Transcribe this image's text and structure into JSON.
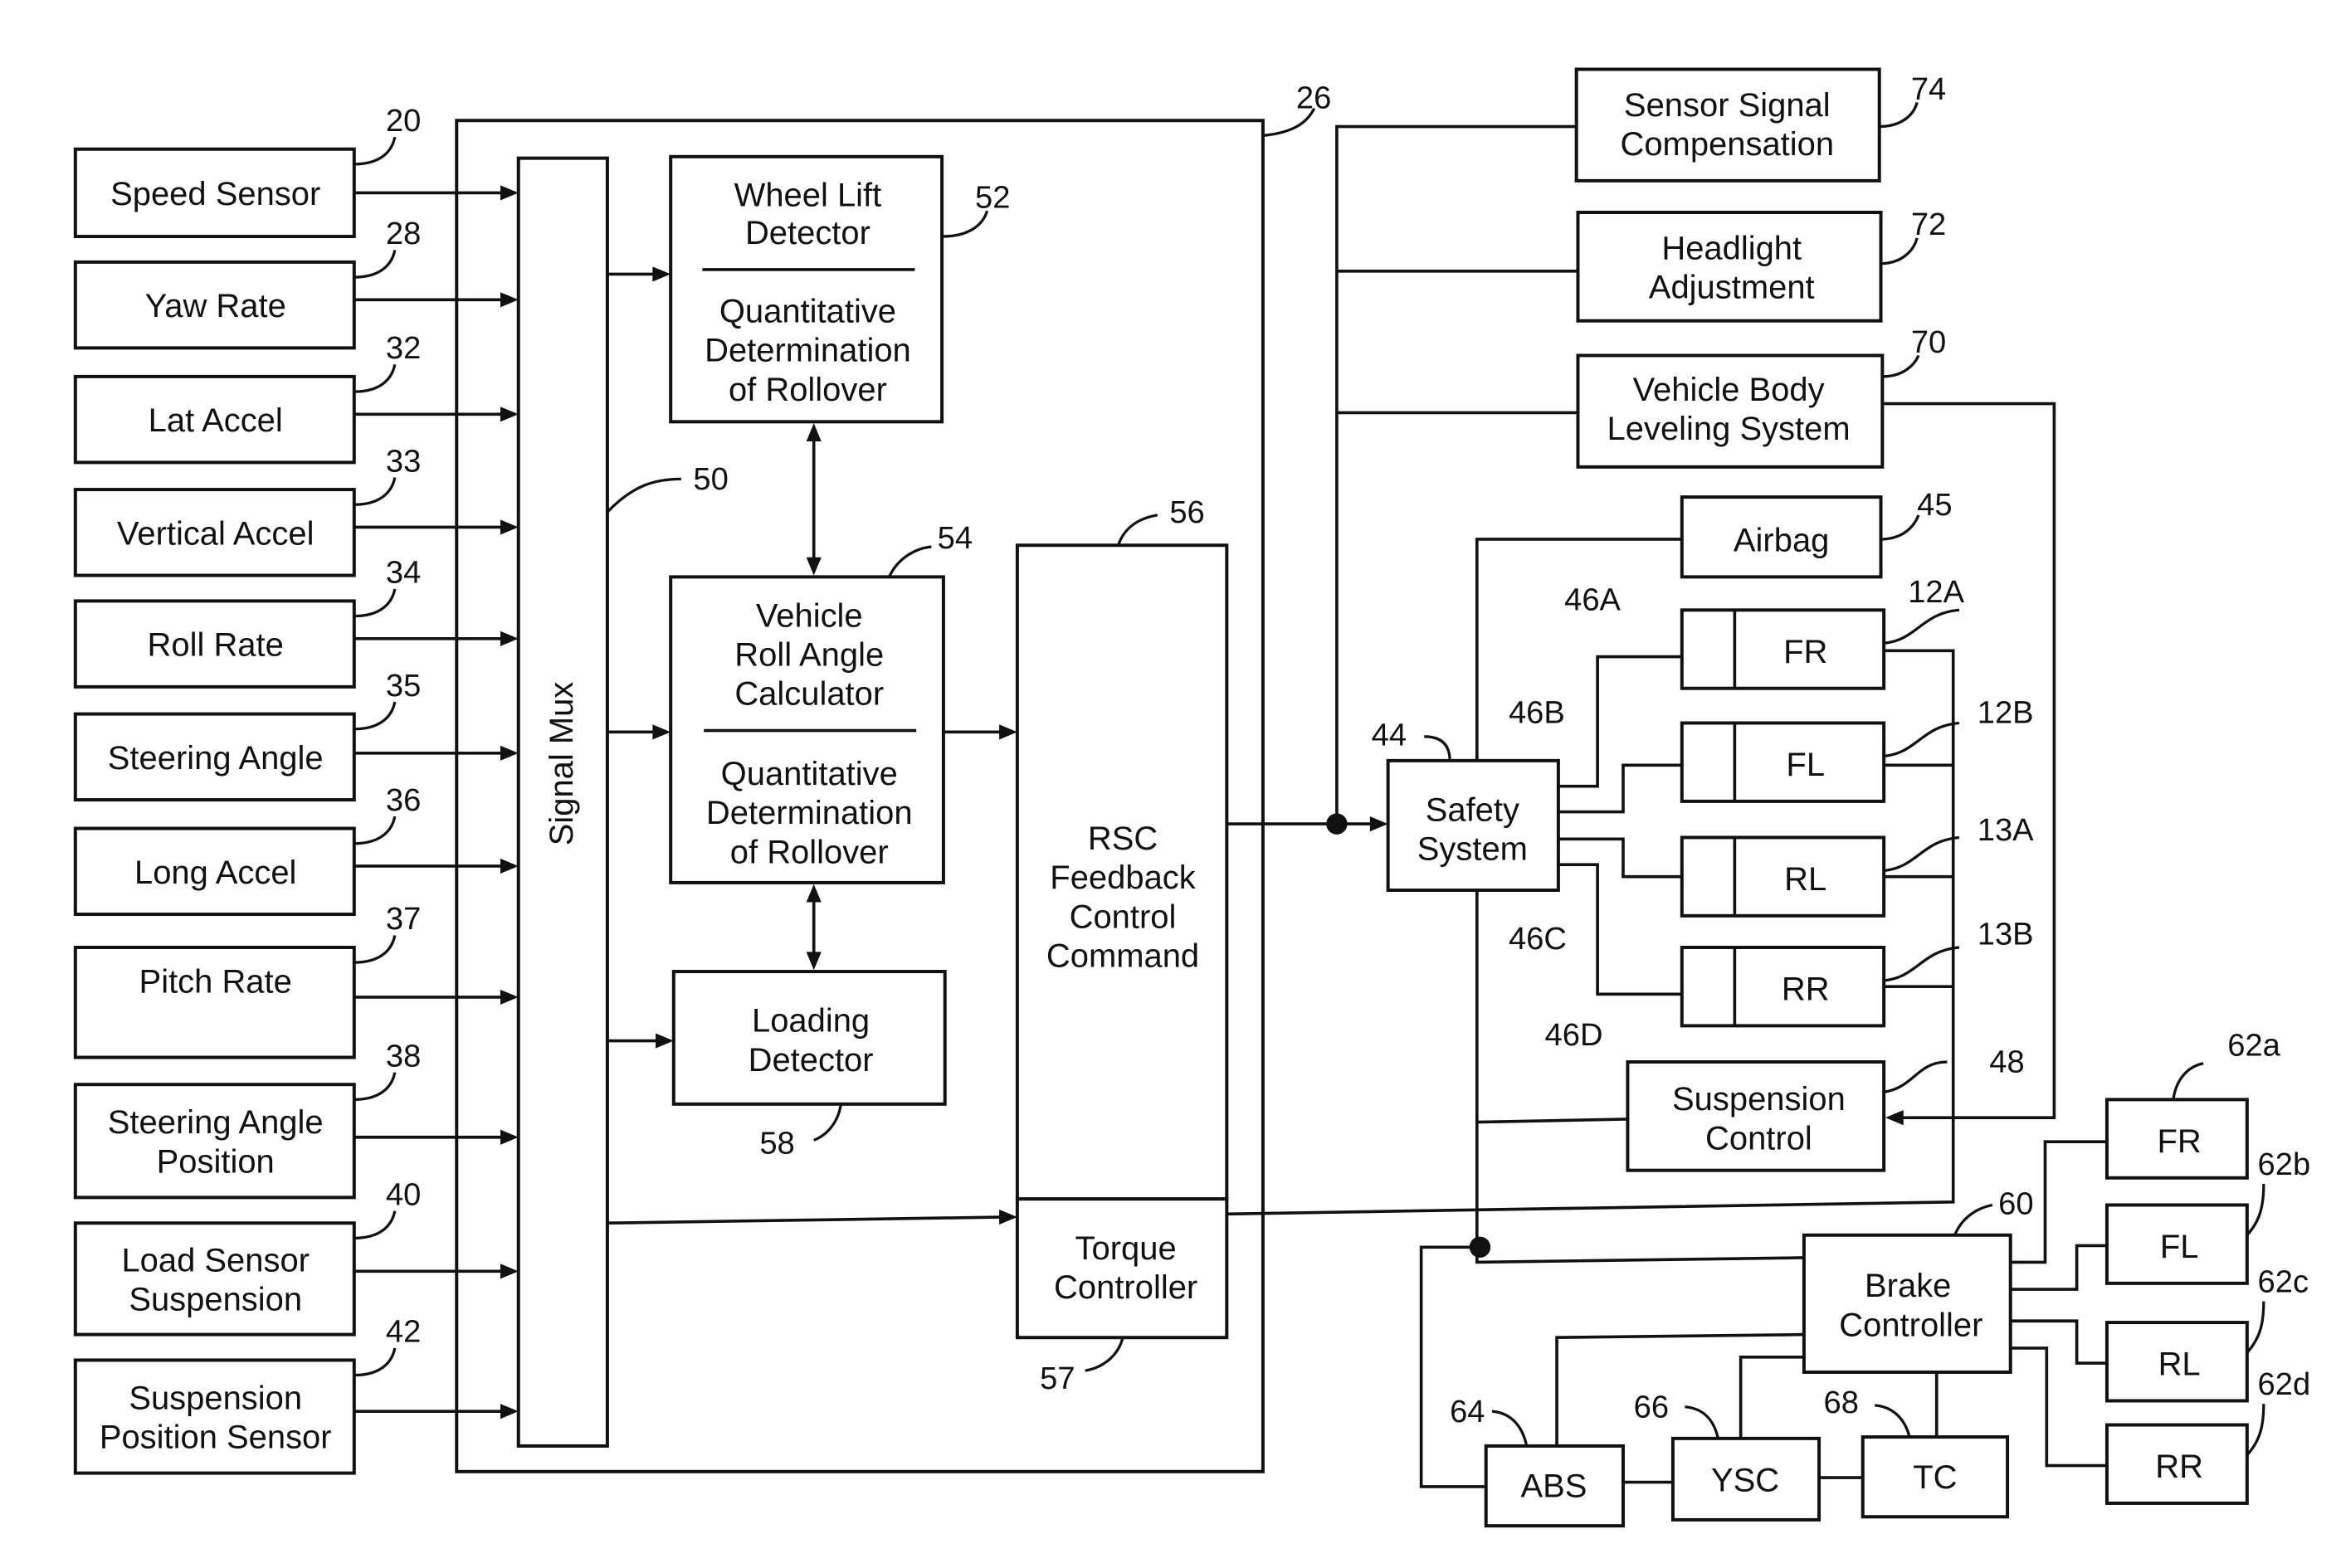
{
  "figure": {
    "sensors": [
      {
        "id": "speed-sensor",
        "lines": [
          "Speed Sensor"
        ],
        "ref": "20"
      },
      {
        "id": "yaw-rate",
        "lines": [
          "Yaw Rate"
        ],
        "ref": "28"
      },
      {
        "id": "lat-accel",
        "lines": [
          "Lat Accel"
        ],
        "ref": "32"
      },
      {
        "id": "vertical-accel",
        "lines": [
          "Vertical Accel"
        ],
        "ref": "33"
      },
      {
        "id": "roll-rate",
        "lines": [
          "Roll Rate"
        ],
        "ref": "34"
      },
      {
        "id": "steering-angle",
        "lines": [
          "Steering Angle"
        ],
        "ref": "35"
      },
      {
        "id": "long-accel",
        "lines": [
          "Long Accel"
        ],
        "ref": "36"
      },
      {
        "id": "pitch-rate",
        "lines": [
          "Pitch Rate"
        ],
        "ref": "37"
      },
      {
        "id": "steering-angle-position",
        "lines": [
          "Steering Angle",
          "Position"
        ],
        "ref": "38"
      },
      {
        "id": "load-sensor-suspension",
        "lines": [
          "Load Sensor",
          "Suspension"
        ],
        "ref": "40"
      },
      {
        "id": "suspension-position-sensor",
        "lines": [
          "Suspension",
          "Position Sensor"
        ],
        "ref": "42"
      }
    ],
    "controller": {
      "ref": "26"
    },
    "signal_mux": {
      "label": "Signal Mux",
      "ref": "50"
    },
    "wheel_lift": {
      "top": [
        "Wheel Lift",
        "Detector"
      ],
      "bottom": [
        "Quantitative",
        "Determination",
        "of Rollover"
      ],
      "ref": "52"
    },
    "roll_angle": {
      "top": [
        "Vehicle",
        "Roll Angle",
        "Calculator"
      ],
      "bottom": [
        "Quantitative",
        "Determination",
        "of Rollover"
      ],
      "ref": "54"
    },
    "loading_detector": {
      "lines": [
        "Loading",
        "Detector"
      ],
      "ref": "58"
    },
    "rsc": {
      "lines": [
        "RSC",
        "Feedback",
        "Control",
        "Command"
      ],
      "ref": "56"
    },
    "torque_controller": {
      "lines": [
        "Torque",
        "Controller"
      ],
      "ref": "57"
    },
    "sensor_signal_comp": {
      "lines": [
        "Sensor Signal",
        "Compensation"
      ],
      "ref": "74"
    },
    "headlight": {
      "lines": [
        "Headlight",
        "Adjustment"
      ],
      "ref": "72"
    },
    "body_leveling": {
      "lines": [
        "Vehicle Body",
        "Leveling System"
      ],
      "ref": "70"
    },
    "airbag": {
      "lines": [
        "Airbag"
      ],
      "ref": "45"
    },
    "safety_system": {
      "lines": [
        "Safety",
        "System"
      ],
      "ref": "44"
    },
    "actuators": [
      {
        "label": "FR",
        "ref": "12A",
        "sub_ref": "46A"
      },
      {
        "label": "FL",
        "ref": "12B",
        "sub_ref": "46B"
      },
      {
        "label": "RL",
        "ref": "13A",
        "sub_ref": "46C"
      },
      {
        "label": "RR",
        "ref": "13B",
        "sub_ref": "46D"
      }
    ],
    "suspension_control": {
      "lines": [
        "Suspension",
        "Control"
      ],
      "ref": "48"
    },
    "brake_controller": {
      "lines": [
        "Brake",
        "Controller"
      ],
      "ref": "60"
    },
    "brakes": [
      {
        "label": "FR",
        "ref": "62a"
      },
      {
        "label": "FL",
        "ref": "62b"
      },
      {
        "label": "RL",
        "ref": "62c"
      },
      {
        "label": "RR",
        "ref": "62d"
      }
    ],
    "abs": {
      "label": "ABS",
      "ref": "64"
    },
    "ysc": {
      "label": "YSC",
      "ref": "66"
    },
    "tc": {
      "label": "TC",
      "ref": "68"
    }
  }
}
